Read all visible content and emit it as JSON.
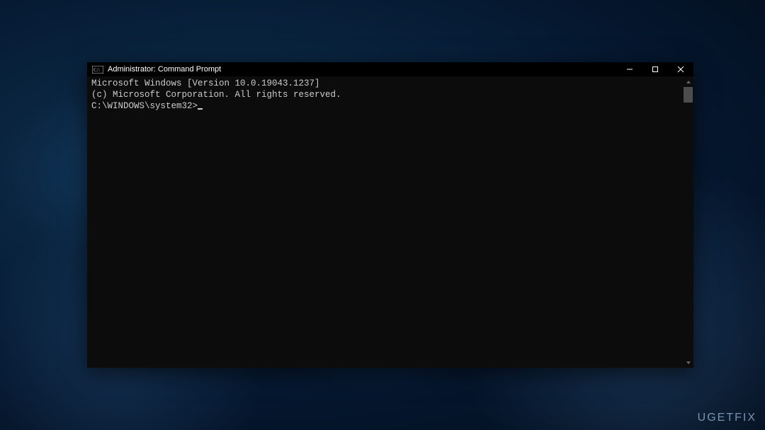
{
  "window": {
    "title": "Administrator: Command Prompt"
  },
  "terminal": {
    "line1": "Microsoft Windows [Version 10.0.19043.1237]",
    "line2": "(c) Microsoft Corporation. All rights reserved.",
    "blank": "",
    "prompt": "C:\\WINDOWS\\system32>"
  },
  "watermark": {
    "text": "UGETFIX"
  }
}
